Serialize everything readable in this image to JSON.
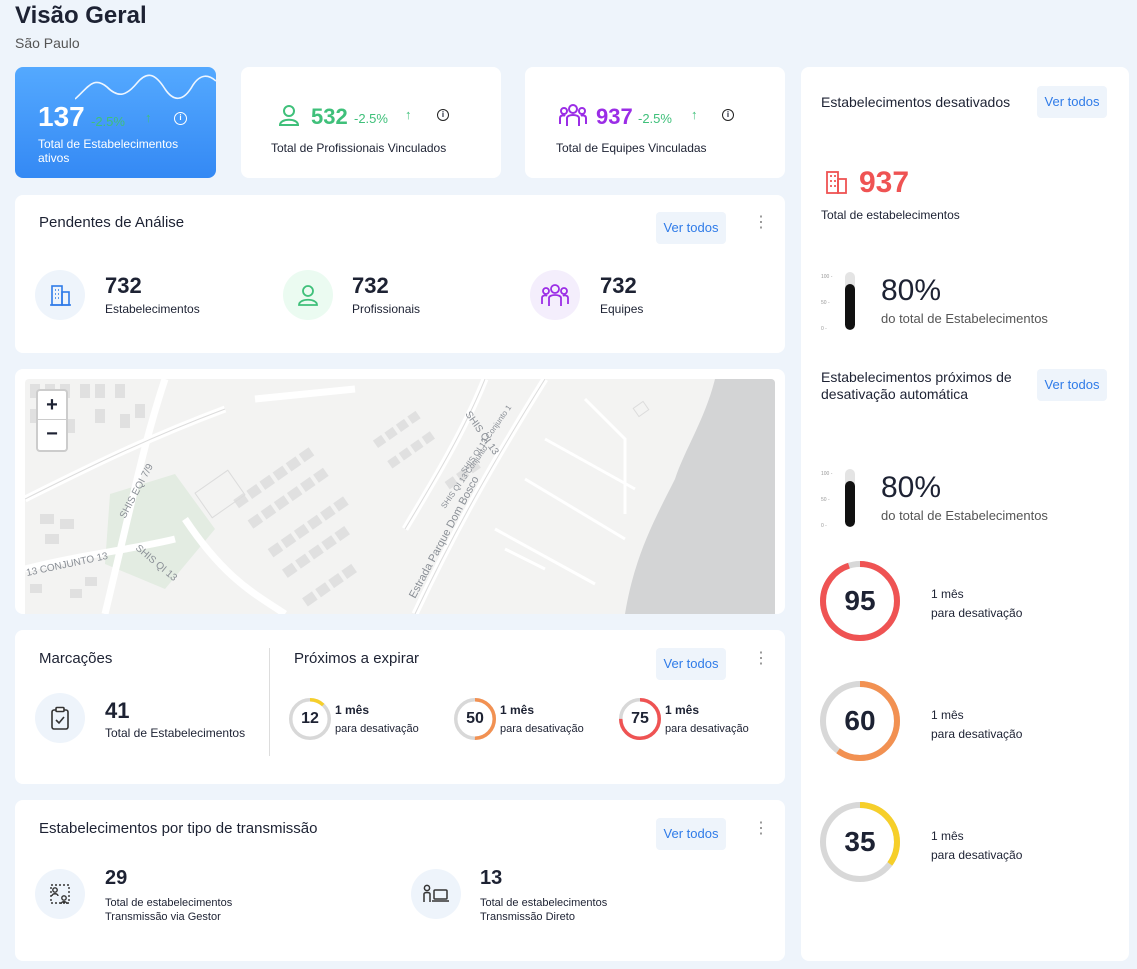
{
  "header": {
    "title": "Visão Geral",
    "subtitle": "São Paulo"
  },
  "stats": [
    {
      "value": "137",
      "delta": "-2.5%",
      "label": "Total de Estabelecimentos ativos",
      "icon": "chart-wave-icon"
    },
    {
      "value": "532",
      "delta": "-2.5%",
      "label": "Total de Profissionais Vinculados",
      "icon": "user-icon"
    },
    {
      "value": "937",
      "delta": "-2.5%",
      "label": "Total de Equipes Vinculadas",
      "icon": "team-icon"
    }
  ],
  "colors": {
    "accent": "#2f7be8",
    "blue_card": "#3f9bff",
    "green": "#3fc07a",
    "purple": "#9b2de6",
    "red": "#ef5353",
    "orange": "#f29152",
    "yellow": "#f6cf2a"
  },
  "pendentes": {
    "title": "Pendentes de Análise",
    "ver_todos": "Ver todos",
    "items": [
      {
        "value": "732",
        "label": "Estabelecimentos",
        "icon": "building-icon"
      },
      {
        "value": "732",
        "label": "Profissionais",
        "icon": "user-icon"
      },
      {
        "value": "732",
        "label": "Equipes",
        "icon": "team-icon"
      }
    ]
  },
  "map": {
    "zoom_in": "+",
    "zoom_out": "−",
    "labels": [
      "SHIS QI 13",
      "SHIS EQI 7/9",
      "SHIS QI 13",
      "13 CONJUNTO 13",
      "SHIS QI 13 Conjunto",
      "SHIS QI 13 Conjunto 1",
      "Estrada Parque Dom Bosco"
    ]
  },
  "marcacoes": {
    "title": "Marcações",
    "value": "41",
    "label": "Total de Estabelecimentos",
    "icon": "clipboard-check-icon"
  },
  "proximos": {
    "title": "Próximos a expirar",
    "ver_todos": "Ver todos",
    "items": [
      {
        "value": "12",
        "line1": "1 mês",
        "line2": "para desativação",
        "percent": 12,
        "color": "#f6cf2a"
      },
      {
        "value": "50",
        "line1": "1 mês",
        "line2": "para desativação",
        "percent": 50,
        "color": "#f29152"
      },
      {
        "value": "75",
        "line1": "1 mês",
        "line2": "para desativação",
        "percent": 75,
        "color": "#ef5353"
      }
    ]
  },
  "transmissao": {
    "title": "Estabelecimentos por tipo de transmissão",
    "ver_todos": "Ver todos",
    "items": [
      {
        "value": "29",
        "line1": "Total de estabelecimentos",
        "line2": "Transmissão via Gestor",
        "icon": "gestor-icon"
      },
      {
        "value": "13",
        "line1": "Total de estabelecimentos",
        "line2": "Transmissão Direto",
        "icon": "computer-user-icon"
      }
    ]
  },
  "desativados": {
    "title": "Estabelecimentos desativados",
    "ver_todos": "Ver todos",
    "value": "937",
    "label": "Total de estabelecimentos",
    "icon": "building-icon",
    "percent_text": "80%",
    "percent_value": 80,
    "percent_label": "do total de Estabelecimentos",
    "axis": [
      "100 -",
      "50 -",
      "0 -"
    ]
  },
  "proximos_desativacao": {
    "title": "Estabelecimentos próximos de desativação automática",
    "ver_todos": "Ver todos",
    "percent_text": "80%",
    "percent_value": 80,
    "percent_label": "do total de Estabelecimentos",
    "axis": [
      "100 -",
      "50 -",
      "0 -"
    ],
    "rings": [
      {
        "value": "95",
        "line1": "1 mês",
        "line2": "para desativação",
        "percent": 95,
        "color": "#ef5353"
      },
      {
        "value": "60",
        "line1": "1 mês",
        "line2": "para desativação",
        "percent": 60,
        "color": "#f29152"
      },
      {
        "value": "35",
        "line1": "1 mês",
        "line2": "para desativação",
        "percent": 35,
        "color": "#f6cf2a"
      }
    ]
  }
}
